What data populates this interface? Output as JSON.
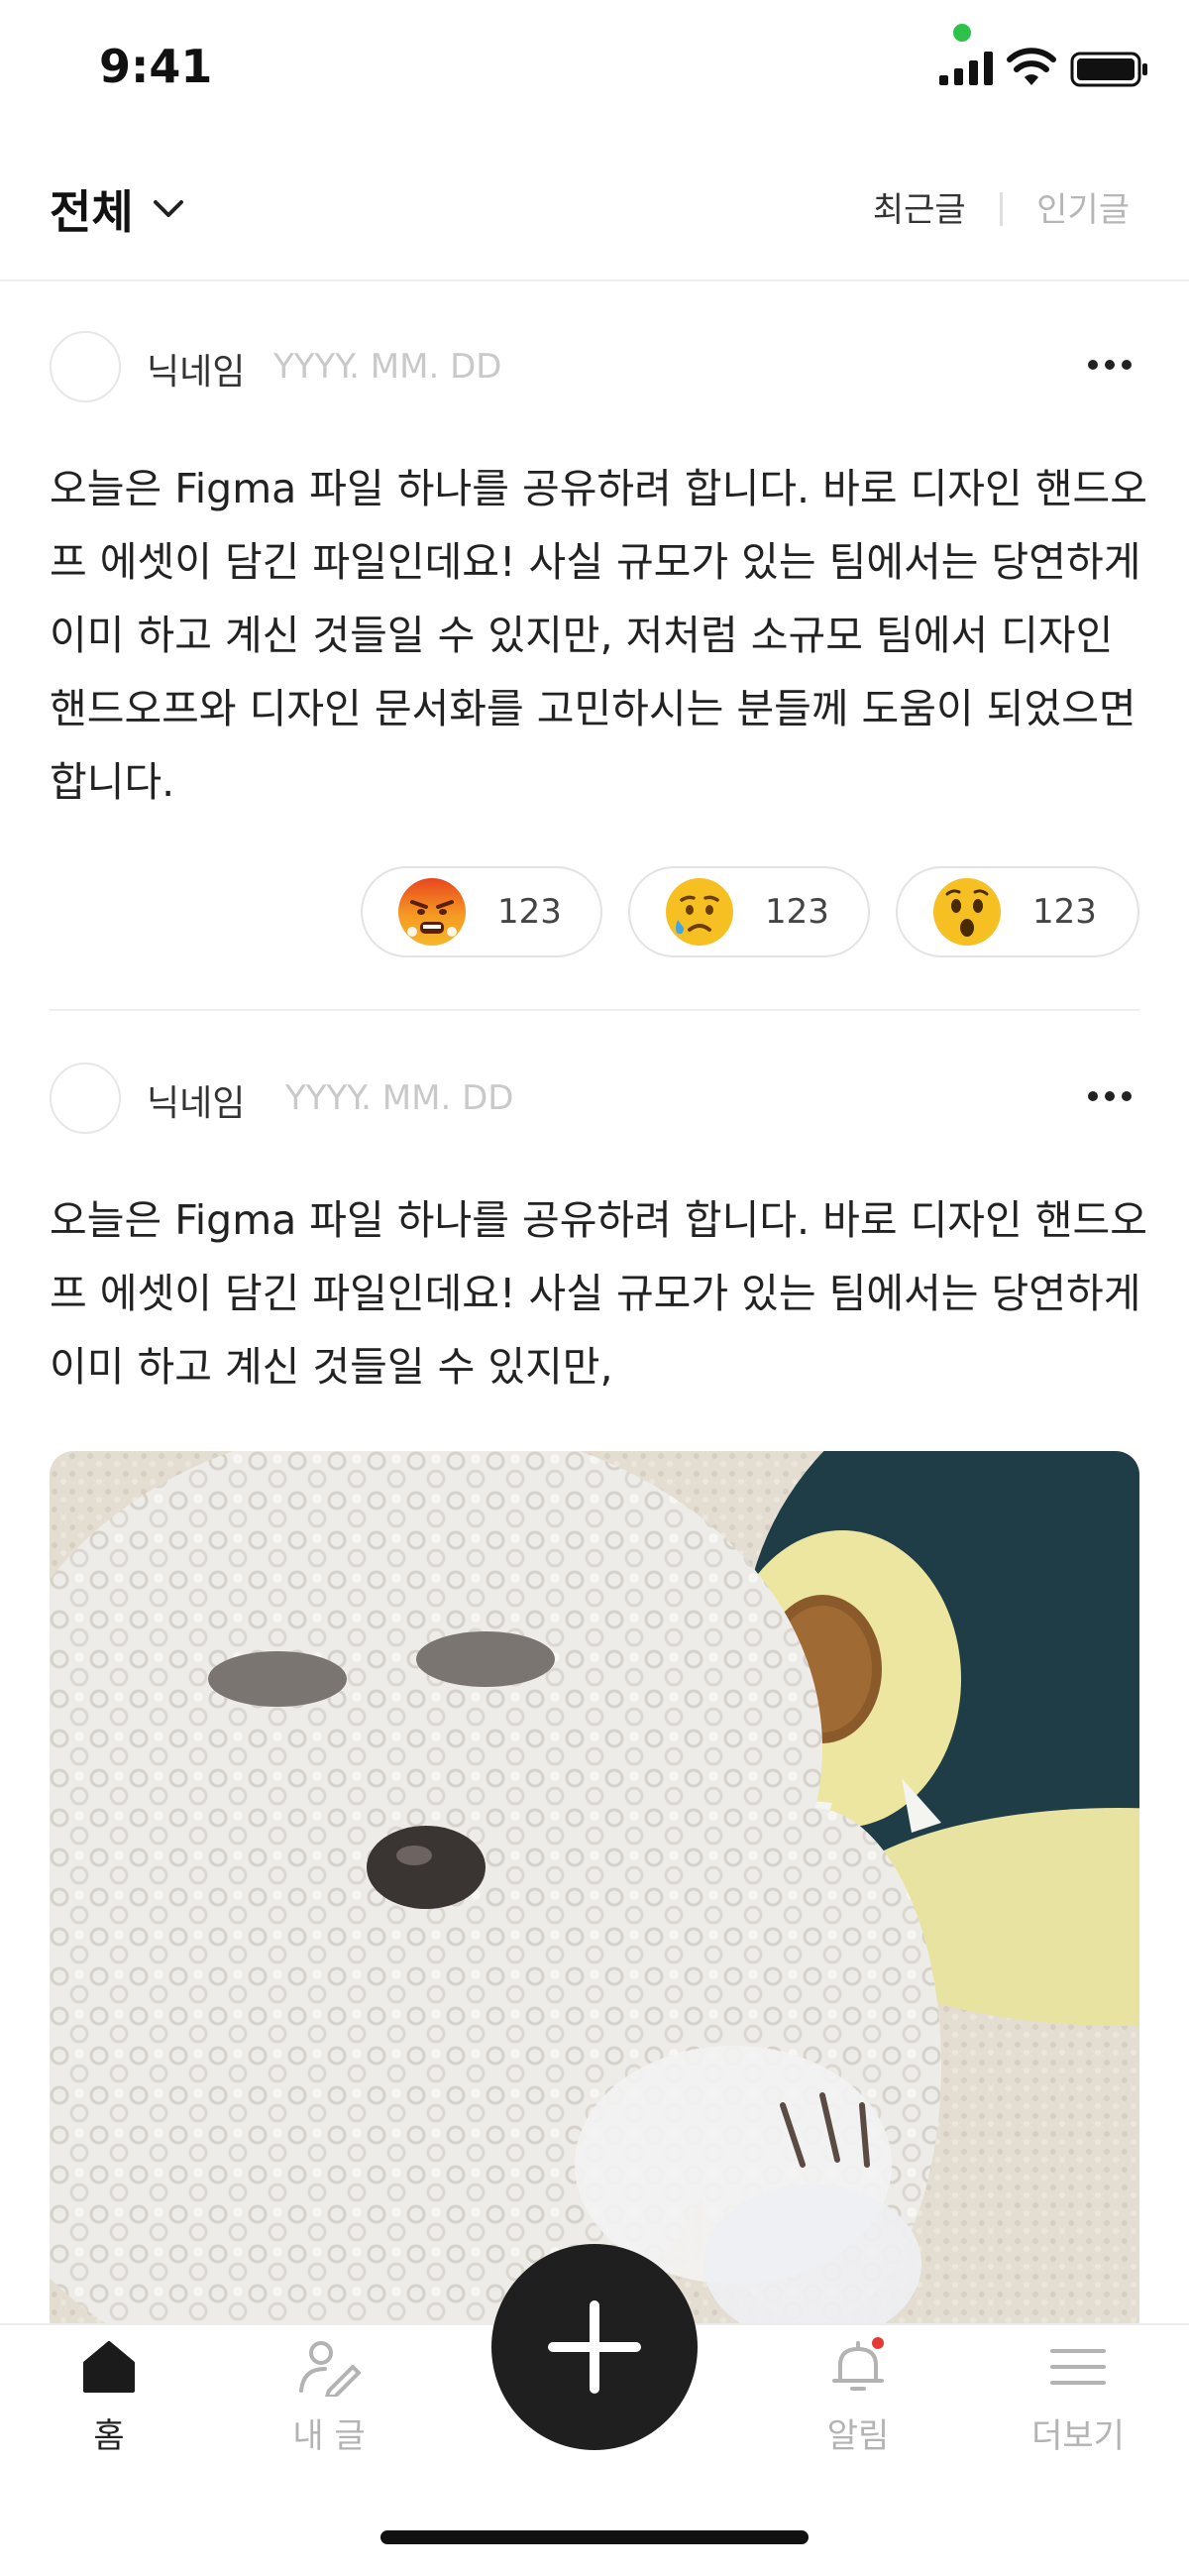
{
  "status_bar": {
    "time": "9:41"
  },
  "header": {
    "filter_label": "전체",
    "sort_recent": "최근글",
    "sort_divider": "|",
    "sort_popular": "인기글"
  },
  "posts": [
    {
      "nickname": "닉네임",
      "date": "YYYY. MM. DD",
      "text": "오늘은 Figma 파일 하나를 공유하려 합니다. 바로 디자인 핸드오프 에셋이 담긴 파일인데요! 사실 규모가 있는 팀에서는 당연하게 이미 하고 계신 것들일 수 있지만, 저처럼 소규모 팀에서 디자인 핸드오프와 디자인 문서화를 고민하시는 분들께 도움이 되었으면 합니다.",
      "reactions": [
        {
          "emoji": "angry-face-icon",
          "count": "123"
        },
        {
          "emoji": "crying-face-icon",
          "count": "123"
        },
        {
          "emoji": "surprised-face-icon",
          "count": "123"
        }
      ]
    },
    {
      "nickname": "닉네임",
      "date": "YYYY. MM. DD",
      "text": "오늘은 Figma 파일 하나를 공유하려 합니다. 바로 디자인 핸드오프 에셋이 담긴 파일인데요! 사실 규모가 있는 팀에서는 당연하게 이미 하고 계신 것들일 수 있지만,"
    }
  ],
  "nav": {
    "home": "홈",
    "my_posts": "내 글",
    "alerts": "알림",
    "more": "더보기"
  },
  "colors": {
    "accent_dark": "#1f1f1f",
    "notification_dot": "#e53935",
    "status_green": "#2ec24a"
  }
}
